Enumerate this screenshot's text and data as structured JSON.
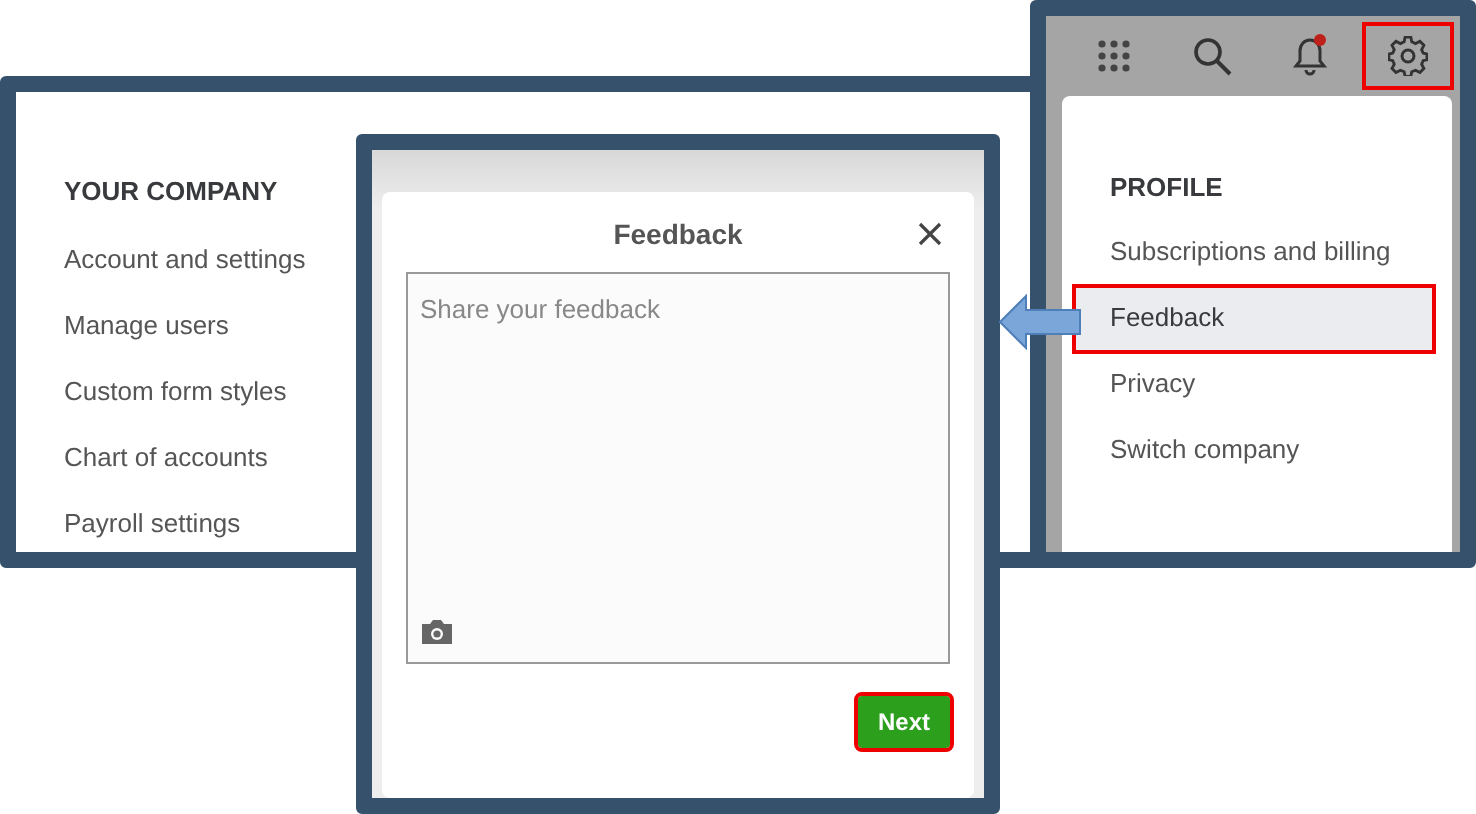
{
  "company_menu": {
    "heading": "YOUR COMPANY",
    "items": [
      "Account and settings",
      "Manage users",
      "Custom form styles",
      "Chart of accounts",
      "Payroll settings"
    ]
  },
  "toolbar": [
    {
      "kind": "apps",
      "highlighted": false,
      "notification": false
    },
    {
      "kind": "search",
      "highlighted": false,
      "notification": false
    },
    {
      "kind": "bell",
      "highlighted": false,
      "notification": true
    },
    {
      "kind": "settings",
      "highlighted": true,
      "notification": false
    }
  ],
  "profile_menu": {
    "heading": "PROFILE",
    "items": [
      {
        "label": "Subscriptions and billing",
        "selected": false
      },
      {
        "label": "Feedback",
        "selected": true
      },
      {
        "label": "Privacy",
        "selected": false
      },
      {
        "label": "Switch company",
        "selected": false
      }
    ]
  },
  "feedback_dialog": {
    "title": "Feedback",
    "placeholder": "Share your feedback",
    "button": {
      "label": "Next",
      "highlighted": true
    }
  }
}
